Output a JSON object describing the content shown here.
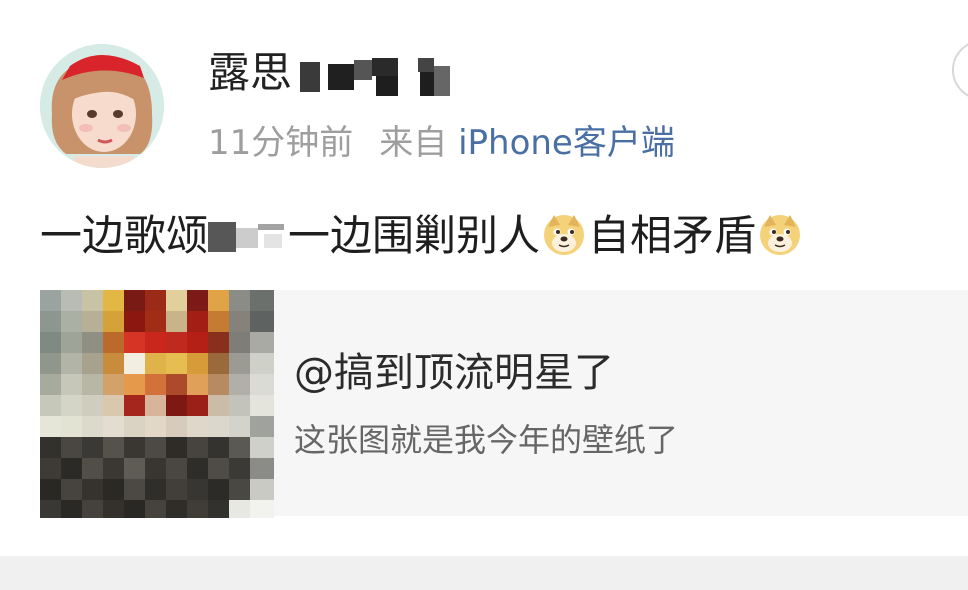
{
  "post": {
    "username": "露思",
    "time_ago": "11分钟前",
    "source_prefix": "来自",
    "source_client": "iPhone客户端",
    "content": {
      "part1": "一边歌颂",
      "part2": "一边围剿别人",
      "part3": "自相矛盾"
    },
    "emoji_icon": "doge-emoji"
  },
  "repost": {
    "author": "@搞到顶流明星了",
    "text": "这张图就是我今年的壁纸了"
  },
  "colors": {
    "link_blue": "#4a6fa5",
    "meta_gray": "#9e9e9e",
    "card_bg": "#f6f6f6"
  }
}
